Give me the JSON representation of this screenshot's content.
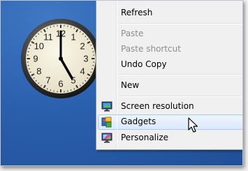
{
  "desktop": {
    "background_color": "#2a5fad",
    "clock_gadget": {
      "numbers": [
        "12",
        "1",
        "2",
        "3",
        "4",
        "5",
        "6",
        "7",
        "8",
        "9",
        "10",
        "11"
      ]
    }
  },
  "context_menu": {
    "items": [
      {
        "label": "Refresh",
        "enabled": true
      },
      {
        "label": "Paste",
        "enabled": false
      },
      {
        "label": "Paste shortcut",
        "enabled": false
      },
      {
        "label": "Undo Copy",
        "enabled": true
      },
      {
        "label": "New",
        "enabled": true,
        "has_submenu": true
      },
      {
        "label": "Screen resolution",
        "enabled": true,
        "icon": "monitor-icon"
      },
      {
        "label": "Gadgets",
        "enabled": true,
        "icon": "gadgets-icon",
        "highlighted": true
      },
      {
        "label": "Personalize",
        "enabled": true,
        "icon": "personalize-icon"
      }
    ]
  },
  "colors": {
    "hover_border": "#a8c8ee",
    "disabled_text": "#8d8d8d"
  }
}
